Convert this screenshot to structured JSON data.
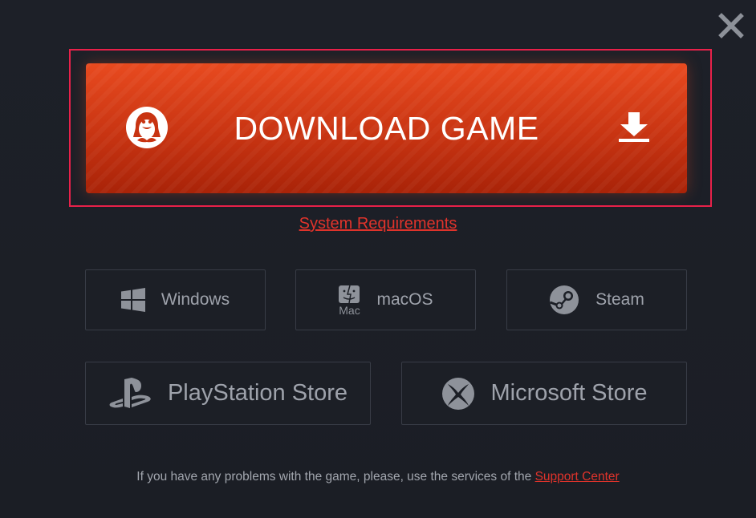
{
  "download": {
    "label": "DOWNLOAD GAME",
    "left_icon": "linux-penguin-icon",
    "right_icon": "download-arrow-icon",
    "accent_color": "#d13a15"
  },
  "links": {
    "system_requirements": "System Requirements"
  },
  "platforms_row1": [
    {
      "label": "Windows",
      "icon": "windows-icon"
    },
    {
      "label": "macOS",
      "icon": "mac-finder-icon",
      "icon_caption": "Mac"
    },
    {
      "label": "Steam",
      "icon": "steam-icon"
    }
  ],
  "platforms_row2": [
    {
      "label": "PlayStation Store",
      "icon": "playstation-icon"
    },
    {
      "label": "Microsoft Store",
      "icon": "xbox-icon"
    }
  ],
  "footer": {
    "text": "If you have any problems with the game, please, use the services of the",
    "link": "Support Center"
  },
  "colors": {
    "background": "#1c1f26",
    "highlight_border": "#e8214a",
    "link": "#e0332b"
  }
}
